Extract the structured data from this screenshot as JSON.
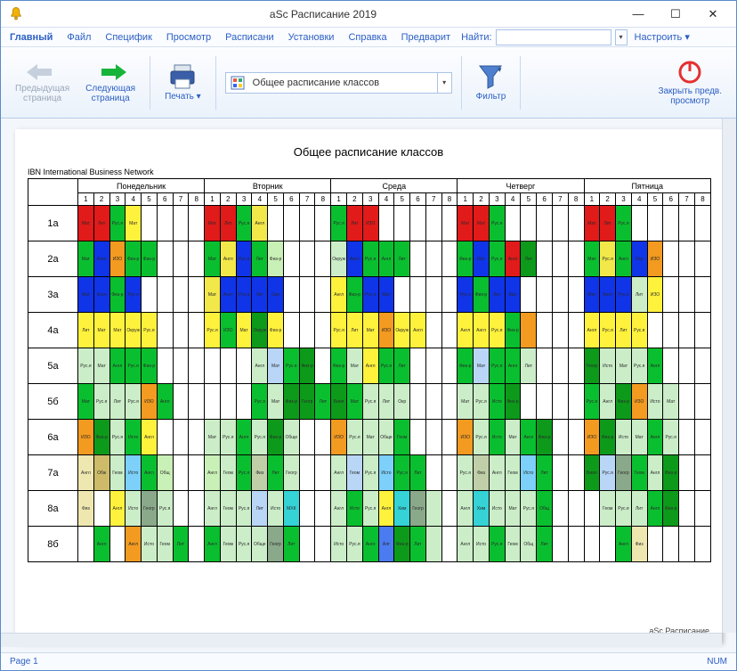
{
  "window": {
    "title": "aSc Расписание 2019",
    "minimize": "—",
    "maximize": "☐",
    "close": "✕"
  },
  "menu": {
    "tabs": [
      "Главный",
      "Файл",
      "Специфик",
      "Просмотр",
      "Расписани",
      "Установки",
      "Справка",
      "Предварит"
    ],
    "search_label": "Найти:",
    "search_value": "",
    "customize": "Настроить ▾"
  },
  "ribbon": {
    "prev": "Предыдущая\nстраница",
    "next": "Следующая\nстраница",
    "print": "Печать ▾",
    "schedule_combo": "Общее расписание классов",
    "filter": "Фильтр",
    "close_preview": "Закрыть предв.\nпросмотр"
  },
  "sheet": {
    "title": "Общее расписание классов",
    "org": "IBN International Business Network",
    "watermark": "aSc Расписание"
  },
  "days": [
    "Понедельник",
    "Вторник",
    "Среда",
    "Четверг",
    "Пятница"
  ],
  "periods": [
    "1",
    "2",
    "3",
    "4",
    "5",
    "6",
    "7",
    "8"
  ],
  "classes": [
    "1а",
    "2а",
    "3а",
    "4а",
    "5а",
    "5б",
    "6а",
    "7а",
    "8а",
    "8б"
  ],
  "palette": {
    "r": "#e11a1a",
    "g": "#0abf2f",
    "b": "#1034e8",
    "bl": "#2646ea",
    "y": "#fff23d",
    "y2": "#f2e84a",
    "lg": "#cbedc8",
    "dg": "#0d9a1b",
    "pg": "#c9f0b6",
    "or": "#f39a20",
    "pk": "#f6c1c1",
    "wh": "#ffffff",
    "cy": "#35d2d6",
    "sk": "#7cd0f9",
    "lb": "#b9d6f7",
    "vb": "#4a7bf0",
    "tn": "#cdbb6a",
    "be": "#efe7b0",
    "gr": "#8aa88a",
    "mg": "#d16fe0",
    "pl": "#ead7f5",
    "na": "#1b3ebf",
    "aq": "#0dd19e",
    "sl": "#c0cfa8"
  },
  "grid": [
    [
      [
        "r",
        "Мат"
      ],
      [
        "r",
        "Лит"
      ],
      [
        "g",
        "Рус.я"
      ],
      [
        "y",
        "Мат"
      ],
      null,
      null,
      null,
      null,
      [
        "r",
        "Мат"
      ],
      [
        "r",
        "Лит"
      ],
      [
        "g",
        "Рус.я"
      ],
      [
        "y2",
        "Англ"
      ],
      null,
      null,
      null,
      null,
      [
        "g",
        "Рус.я"
      ],
      [
        "r",
        "Лит"
      ],
      [
        "r",
        "ИЗО"
      ],
      null,
      null,
      null,
      null,
      null,
      [
        "r",
        "Мат"
      ],
      [
        "r",
        "Мат"
      ],
      [
        "g",
        "Рус.я"
      ],
      null,
      null,
      null,
      null,
      null,
      [
        "r",
        "Мат"
      ],
      [
        "r",
        "Лит"
      ],
      [
        "g",
        "Рус.я"
      ],
      null,
      null,
      null,
      null,
      null
    ],
    [
      [
        "g",
        "Мат"
      ],
      [
        "b",
        "Англ"
      ],
      [
        "or",
        "ИЗО"
      ],
      [
        "g",
        "Физ-р"
      ],
      [
        "g",
        "Физ-р"
      ],
      null,
      null,
      null,
      [
        "g",
        "Мат"
      ],
      [
        "y2",
        "Англ"
      ],
      [
        "b",
        "Рус.я"
      ],
      [
        "g",
        "Лит"
      ],
      [
        "pg",
        "Физ-р"
      ],
      null,
      null,
      null,
      [
        "lg",
        "Окруж"
      ],
      [
        "b",
        "Англ"
      ],
      [
        "g",
        "Рус.я"
      ],
      [
        "g",
        "Англ"
      ],
      [
        "g",
        "Лит"
      ],
      null,
      null,
      null,
      [
        "g",
        "Физ-р"
      ],
      [
        "b",
        "Мат"
      ],
      [
        "g",
        "Рус.я"
      ],
      [
        "r",
        "Англ"
      ],
      [
        "dg",
        "Лит"
      ],
      null,
      null,
      null,
      [
        "g",
        "Мат"
      ],
      [
        "y2",
        "Рус.я"
      ],
      [
        "g",
        "Англ"
      ],
      [
        "b",
        "Окр"
      ],
      [
        "or",
        "ИЗО"
      ],
      null,
      null,
      null
    ],
    [
      [
        "b",
        "Мат"
      ],
      [
        "b",
        "Англ"
      ],
      [
        "g",
        "Физ-р"
      ],
      [
        "b",
        "Рус.я"
      ],
      null,
      null,
      null,
      null,
      [
        "y2",
        "Мат"
      ],
      [
        "b",
        "Англ"
      ],
      [
        "b",
        "Рус.я"
      ],
      [
        "b",
        "Лит"
      ],
      [
        "b",
        "Окр"
      ],
      null,
      null,
      null,
      [
        "y",
        "Англ"
      ],
      [
        "g",
        "Физ-р"
      ],
      [
        "b",
        "Рус.я"
      ],
      [
        "b",
        "Мат"
      ],
      null,
      null,
      null,
      null,
      [
        "b",
        "Рус.я"
      ],
      [
        "g",
        "Физ-р"
      ],
      [
        "b",
        "Лит"
      ],
      [
        "b",
        "Мат"
      ],
      null,
      null,
      null,
      null,
      [
        "b",
        "Мат"
      ],
      [
        "b",
        "Англ"
      ],
      [
        "b",
        "Рус.я"
      ],
      [
        "lg",
        "Лит"
      ],
      [
        "y",
        "ИЗО"
      ],
      null,
      null,
      null
    ],
    [
      [
        "y",
        "Лит"
      ],
      [
        "y",
        "Мат"
      ],
      [
        "y",
        "Мат"
      ],
      [
        "y",
        "Окруж"
      ],
      [
        "y",
        "Рус.я"
      ],
      null,
      null,
      null,
      [
        "y",
        "Рус.я"
      ],
      [
        "g",
        "ИЗО"
      ],
      [
        "y",
        "Мат"
      ],
      [
        "dg",
        "Окруж"
      ],
      [
        "y",
        "Физ-р"
      ],
      null,
      null,
      null,
      [
        "y",
        "Рус.я"
      ],
      [
        "y",
        "Лит"
      ],
      [
        "y",
        "Мат"
      ],
      [
        "or",
        "ИЗО"
      ],
      [
        "y",
        "Окруж"
      ],
      [
        "y",
        "Англ"
      ],
      null,
      null,
      [
        "y",
        "Англ"
      ],
      [
        "y",
        "Англ"
      ],
      [
        "y",
        "Рус.я"
      ],
      [
        "g",
        "Физ-р"
      ],
      [
        "or",
        ""
      ],
      null,
      null,
      null,
      [
        "y",
        "Англ"
      ],
      [
        "y",
        "Рус.я"
      ],
      [
        "y",
        "Лит"
      ],
      [
        "y",
        "Рус.я"
      ],
      null,
      null,
      null,
      null
    ],
    [
      [
        "lg",
        "Рус.я"
      ],
      [
        "lg",
        "Мат"
      ],
      [
        "g",
        "Англ"
      ],
      [
        "g",
        "Рус.я"
      ],
      [
        "g",
        "Физ-р"
      ],
      null,
      null,
      null,
      null,
      null,
      null,
      [
        "lg",
        "Англ"
      ],
      [
        "lb",
        "Мат"
      ],
      [
        "g",
        "Рус.я"
      ],
      [
        "dg",
        "Физ-р"
      ],
      null,
      [
        "g",
        "Физ-р"
      ],
      [
        "lg",
        "Мат"
      ],
      [
        "y",
        "Англ"
      ],
      [
        "g",
        "Рус.я"
      ],
      [
        "g",
        "Лит"
      ],
      null,
      null,
      null,
      [
        "g",
        "Физ-р"
      ],
      [
        "lb",
        "Мат"
      ],
      [
        "g",
        "Рус.я"
      ],
      [
        "g",
        "Англ"
      ],
      [
        "lg",
        "Лит"
      ],
      null,
      null,
      null,
      [
        "dg",
        "Геогр"
      ],
      [
        "lg",
        "Исто"
      ],
      [
        "lg",
        "Мат"
      ],
      [
        "lg",
        "Рус.я"
      ],
      [
        "g",
        "Англ"
      ],
      null,
      null,
      null
    ],
    [
      [
        "g",
        "Мат"
      ],
      [
        "lg",
        "Рус.я"
      ],
      [
        "lg",
        "Лит"
      ],
      [
        "lg",
        "Рус.я"
      ],
      [
        "or",
        "ИЗО"
      ],
      [
        "g",
        "Англ"
      ],
      null,
      null,
      null,
      null,
      null,
      [
        "g",
        "Рус.я"
      ],
      [
        "lg",
        "Мат"
      ],
      [
        "dg",
        "Физ-р"
      ],
      [
        "dg",
        "Геогр"
      ],
      [
        "g",
        "Лит"
      ],
      [
        "dg",
        "Биол"
      ],
      [
        "g",
        "Мат"
      ],
      [
        "lg",
        "Рус.я"
      ],
      [
        "lg",
        "Лит"
      ],
      [
        "lg",
        "Окр"
      ],
      null,
      null,
      null,
      [
        "lg",
        "Мат"
      ],
      [
        "lg",
        "Рус.я"
      ],
      [
        "g",
        "Исто"
      ],
      [
        "dg",
        "Физ-р"
      ],
      null,
      null,
      null,
      null,
      [
        "g",
        "Рус.я"
      ],
      [
        "lg",
        "Англ"
      ],
      [
        "dg",
        "Физ-р"
      ],
      [
        "or",
        "ИЗО"
      ],
      [
        "lg",
        "Исто"
      ],
      [
        "lg",
        "Мат"
      ],
      null,
      null
    ],
    [
      [
        "or",
        "ИЗО"
      ],
      [
        "dg",
        "Физ-р"
      ],
      [
        "lg",
        "Рус.я"
      ],
      [
        "g",
        "Исто"
      ],
      [
        "y",
        "Англ"
      ],
      null,
      null,
      null,
      [
        "lg",
        "Мат"
      ],
      [
        "lg",
        "Рус.я"
      ],
      [
        "g",
        "Англ"
      ],
      [
        "lg",
        "Рус.я"
      ],
      [
        "dg",
        "Физ-р"
      ],
      [
        "lg",
        "Обще"
      ],
      null,
      null,
      [
        "or",
        "ИЗО"
      ],
      [
        "lg",
        "Рус.я"
      ],
      [
        "lg",
        "Мат"
      ],
      [
        "lg",
        "Обще"
      ],
      [
        "g",
        "Геом"
      ],
      null,
      null,
      null,
      [
        "or",
        "ИЗО"
      ],
      [
        "lg",
        "Рус.я"
      ],
      [
        "g",
        "Исто"
      ],
      [
        "lg",
        "Мат"
      ],
      [
        "g",
        "Англ"
      ],
      [
        "dg",
        "Физ-р"
      ],
      null,
      null,
      [
        "or",
        "ИЗО"
      ],
      [
        "dg",
        "Физ-р"
      ],
      [
        "lg",
        "Исто"
      ],
      [
        "lg",
        "Мат"
      ],
      [
        "g",
        "Англ"
      ],
      [
        "lg",
        "Рус.я"
      ],
      null,
      null
    ],
    [
      [
        "be",
        "Англ"
      ],
      [
        "tn",
        "Обж"
      ],
      [
        "lg",
        "Геом"
      ],
      [
        "sk",
        "Исто"
      ],
      [
        "g",
        "Англ"
      ],
      [
        "pg",
        "Общ"
      ],
      null,
      null,
      [
        "pg",
        "Англ"
      ],
      [
        "lg",
        "Геом"
      ],
      [
        "g",
        "Рус.я"
      ],
      [
        "sl",
        "Физ"
      ],
      [
        "g",
        "Лит"
      ],
      [
        "lg",
        "Геогр"
      ],
      null,
      null,
      [
        "lg",
        "Англ"
      ],
      [
        "lb",
        "Геом"
      ],
      [
        "lg",
        "Рус.я"
      ],
      [
        "sk",
        "Исто"
      ],
      [
        "g",
        "Рус.я"
      ],
      [
        "g",
        "Лит"
      ],
      null,
      null,
      [
        "lg",
        "Рус.я"
      ],
      [
        "sl",
        "Физ"
      ],
      [
        "lg",
        "Англ"
      ],
      [
        "lg",
        "Геом"
      ],
      [
        "sk",
        "Исто"
      ],
      [
        "g",
        "Лит"
      ],
      null,
      null,
      [
        "dg",
        "Биол"
      ],
      [
        "lb",
        "Рус.я"
      ],
      [
        "gr",
        "Геогр"
      ],
      [
        "g",
        "Геом"
      ],
      [
        "lg",
        "Англ"
      ],
      [
        "dg",
        "Физ-р"
      ],
      null,
      null
    ],
    [
      [
        "be",
        "Физ"
      ],
      null,
      [
        "y",
        "Англ"
      ],
      [
        "lg",
        "Исто"
      ],
      [
        "gr",
        "Геогр"
      ],
      [
        "lg",
        "Рус.я"
      ],
      null,
      null,
      [
        "lg",
        "Англ"
      ],
      [
        "lg",
        "Геом"
      ],
      [
        "lg",
        "Рус.я"
      ],
      [
        "lb",
        "Лит"
      ],
      [
        "lg",
        "Исто"
      ],
      [
        "cy",
        "МХК"
      ],
      null,
      null,
      [
        "lg",
        "Англ"
      ],
      [
        "g",
        "Исто"
      ],
      [
        "lg",
        "Рус.я"
      ],
      [
        "y",
        "Англ"
      ],
      [
        "cy",
        "Хим"
      ],
      [
        "gr",
        "Геогр"
      ],
      [
        "lg",
        ""
      ],
      null,
      [
        "lg",
        "Англ"
      ],
      [
        "cy",
        "Хим"
      ],
      [
        "lg",
        "Исто"
      ],
      [
        "lg",
        "Мат"
      ],
      [
        "lg",
        "Рус.я"
      ],
      [
        "g",
        "Общ"
      ],
      null,
      null,
      null,
      [
        "lg",
        "Геом"
      ],
      [
        "lg",
        "Рус.я"
      ],
      [
        "lg",
        "Лит"
      ],
      [
        "g",
        "Англ"
      ],
      [
        "dg",
        "Физ-р"
      ],
      null,
      null
    ],
    [
      null,
      [
        "g",
        "Англ"
      ],
      null,
      [
        "or",
        "Англ"
      ],
      [
        "lg",
        "Исто"
      ],
      [
        "lg",
        "Геом"
      ],
      [
        "g",
        "Лит"
      ],
      null,
      [
        "g",
        "Англ"
      ],
      [
        "lg",
        "Геом"
      ],
      [
        "lg",
        "Рус.я"
      ],
      [
        "lg",
        "Обще"
      ],
      [
        "gr",
        "Геогр"
      ],
      [
        "g",
        "Лит"
      ],
      null,
      null,
      [
        "lg",
        "Исто"
      ],
      [
        "lg",
        "Рус.я"
      ],
      [
        "g",
        "Англ"
      ],
      [
        "vb",
        "Алг"
      ],
      [
        "dg",
        "Физ-р"
      ],
      [
        "g",
        "Лит"
      ],
      [
        "lg",
        ""
      ],
      null,
      [
        "lg",
        "Англ"
      ],
      [
        "lg",
        "Исто"
      ],
      [
        "g",
        "Рус.я"
      ],
      [
        "lg",
        "Геом"
      ],
      [
        "lg",
        "Общ"
      ],
      [
        "g",
        "Лит"
      ],
      null,
      null,
      null,
      null,
      [
        "g",
        "Англ"
      ],
      [
        "be",
        "Физ"
      ],
      null,
      null,
      null,
      null
    ]
  ],
  "status": {
    "page": "Page 1",
    "num": "NUM"
  }
}
